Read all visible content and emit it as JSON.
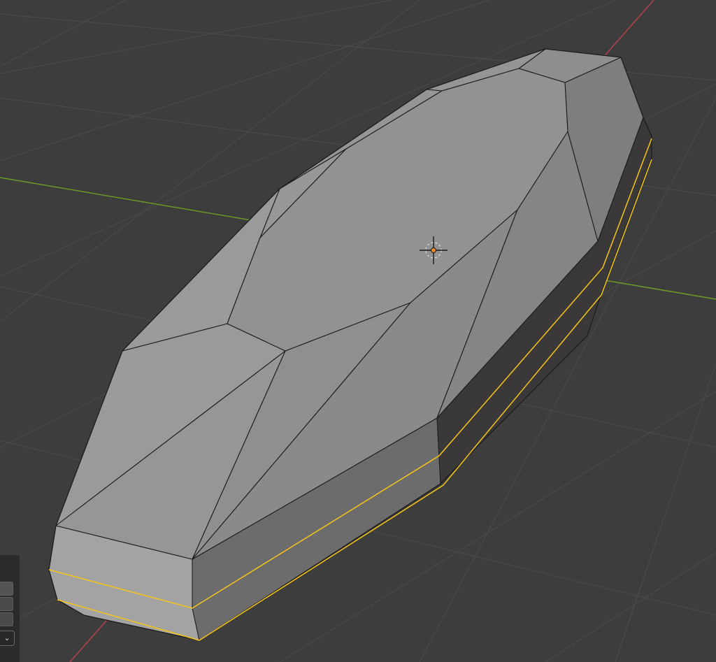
{
  "colors": {
    "background": "#3d3d3d",
    "grid_line": "#4a4a4a",
    "x_axis": "#b5434d",
    "y_axis": "#6a9a2a",
    "mesh_face": "#919191",
    "mesh_edge": "#1c1c1c",
    "selected_edge": "#f5c518",
    "origin": "#f08a24"
  },
  "icons": {
    "object_origin": "origin-crosshair-icon",
    "dropdown": "chevron-down-icon"
  },
  "side_panel": {
    "dropdown_glyph": "⌄"
  }
}
